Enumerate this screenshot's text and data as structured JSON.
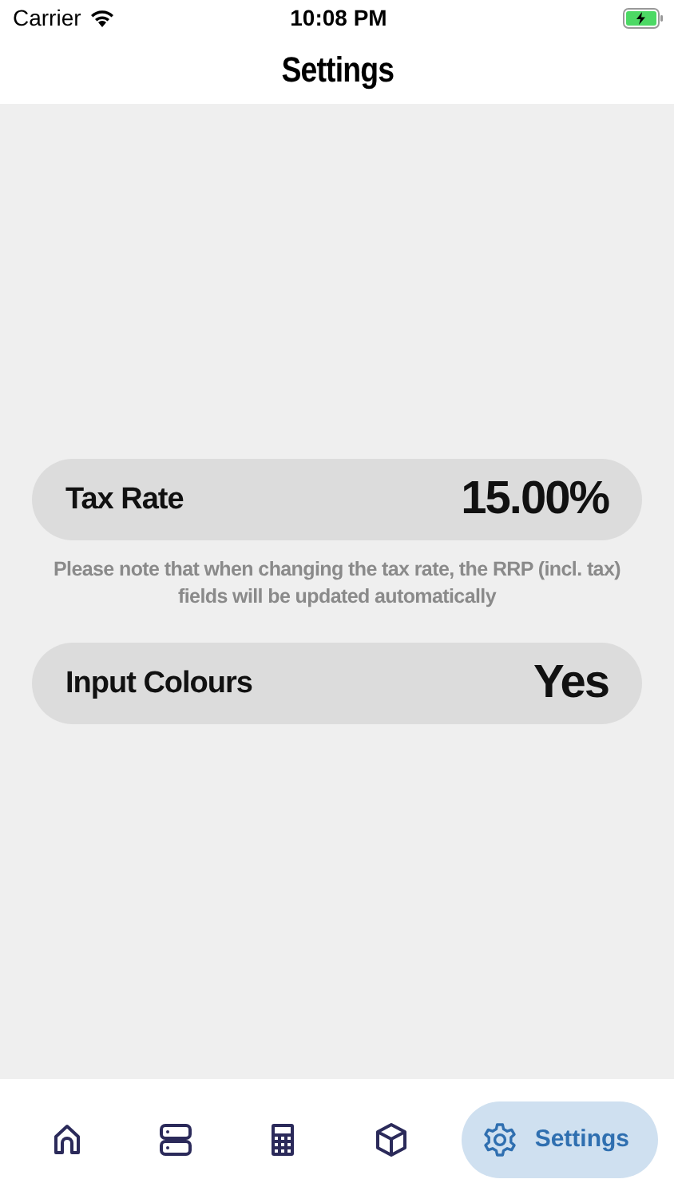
{
  "status_bar": {
    "carrier": "Carrier",
    "time": "10:08 PM"
  },
  "title": "Settings",
  "settings": [
    {
      "label": "Tax Rate",
      "value": "15.00%",
      "note": "Please note that when changing the tax rate, the RRP (incl. tax) fields will be updated automatically"
    },
    {
      "label": "Input Colours",
      "value": "Yes"
    }
  ],
  "tabs": [
    {
      "kind": "home",
      "selected": false
    },
    {
      "kind": "server",
      "selected": false
    },
    {
      "kind": "calculator",
      "selected": false
    },
    {
      "kind": "box",
      "selected": false
    },
    {
      "kind": "settings",
      "selected": true,
      "label": "Settings"
    }
  ]
}
